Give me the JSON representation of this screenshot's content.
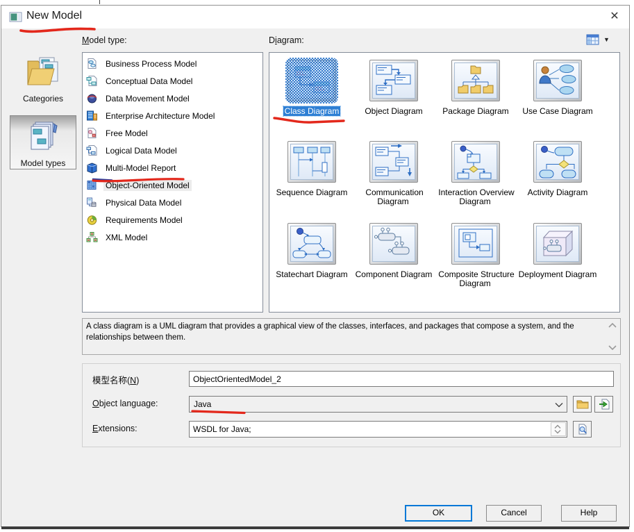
{
  "window": {
    "title": "New Model",
    "close_glyph": "✕",
    "dropdown_glyph": "▼"
  },
  "section_labels": {
    "model_type": {
      "pre": "",
      "accel": "M",
      "post": "odel type:"
    },
    "diagram": {
      "pre": "D",
      "accel": "i",
      "post": "agram:"
    }
  },
  "sidebar": {
    "categories": "Categories",
    "model_types": "Model types"
  },
  "model_types": [
    "Business Process Model",
    "Conceptual Data Model",
    "Data Movement Model",
    "Enterprise Architecture Model",
    "Free Model",
    "Logical Data Model",
    "Multi-Model Report",
    "Object-Oriented Model",
    "Physical Data Model",
    "Requirements Model",
    "XML Model"
  ],
  "selected_model_type": "Object-Oriented Model",
  "diagrams": [
    "Class Diagram",
    "Object Diagram",
    "Package Diagram",
    "Use Case Diagram",
    "Sequence Diagram",
    "Communication Diagram",
    "Interaction Overview Diagram",
    "Activity Diagram",
    "Statechart Diagram",
    "Component Diagram",
    "Composite Structure Diagram",
    "Deployment Diagram"
  ],
  "selected_diagram": "Class Diagram",
  "description": "A class diagram is a UML diagram that provides a graphical view of the classes, interfaces, and packages that compose a system, and the relationships between them.",
  "form": {
    "name_label": {
      "pre": "模型名称(",
      "accel": "N",
      "post": ")"
    },
    "name_value": "ObjectOrientedModel_2",
    "language_label": {
      "pre": "",
      "accel": "O",
      "post": "bject language:"
    },
    "language_value": "Java",
    "extensions_label": {
      "pre": "",
      "accel": "E",
      "post": "xtensions:"
    },
    "extensions_value": "WSDL for Java;"
  },
  "buttons": {
    "ok": "OK",
    "cancel": "Cancel",
    "help": "Help"
  },
  "colors": {
    "selection_blue": "#2e7fd4",
    "annotation_red": "#e3281c",
    "ok_border": "#0078d7"
  }
}
